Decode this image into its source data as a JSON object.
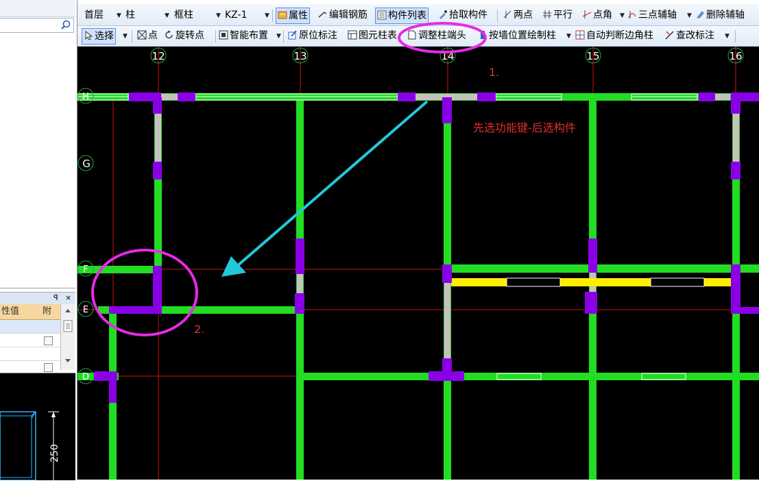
{
  "toolbar1": {
    "floor": "首层",
    "category": "柱",
    "type": "框柱",
    "component": "KZ-1",
    "properties": "属性",
    "edit_rebar": "编辑钢筋",
    "component_list": "构件列表",
    "pick_component": "拾取构件",
    "two_points": "两点",
    "parallel": "平行",
    "point_angle": "点角",
    "three_point_axis": "三点辅轴",
    "delete_axis": "删除辅轴"
  },
  "toolbar2": {
    "select": "选择",
    "point": "点",
    "rotate_point": "旋转点",
    "smart_layout": "智能布置",
    "original_label": "原位标注",
    "element_table": "图元柱表",
    "adjust_column_head": "调整柱端头",
    "draw_by_wall": "按墙位置绘制柱",
    "auto_corner_column": "自动判断边角柱",
    "check_label": "查改标注"
  },
  "property_panel": {
    "header_value": "性值",
    "header_attach": "附",
    "pin": "ꟼ",
    "close": "×"
  },
  "preview": {
    "dimension": "250"
  },
  "canvas": {
    "axis_numbers": [
      "12",
      "13",
      "14",
      "15",
      "16"
    ],
    "axis_letters": [
      "G",
      "F",
      "E",
      "D"
    ],
    "axis_letter_top": "H",
    "annotation_1": "1.",
    "annotation_2": "2.",
    "instruction": "先选功能键-后选构件",
    "colors": {
      "beam_green": "#22dd22",
      "column_purple": "#8a00e6",
      "wall_yellow": "#ffee00",
      "highlight_magenta": "#e62be6",
      "arrow_cyan": "#22c8d8",
      "axis_red": "#d01010",
      "annotation_red": "#e03030"
    }
  }
}
